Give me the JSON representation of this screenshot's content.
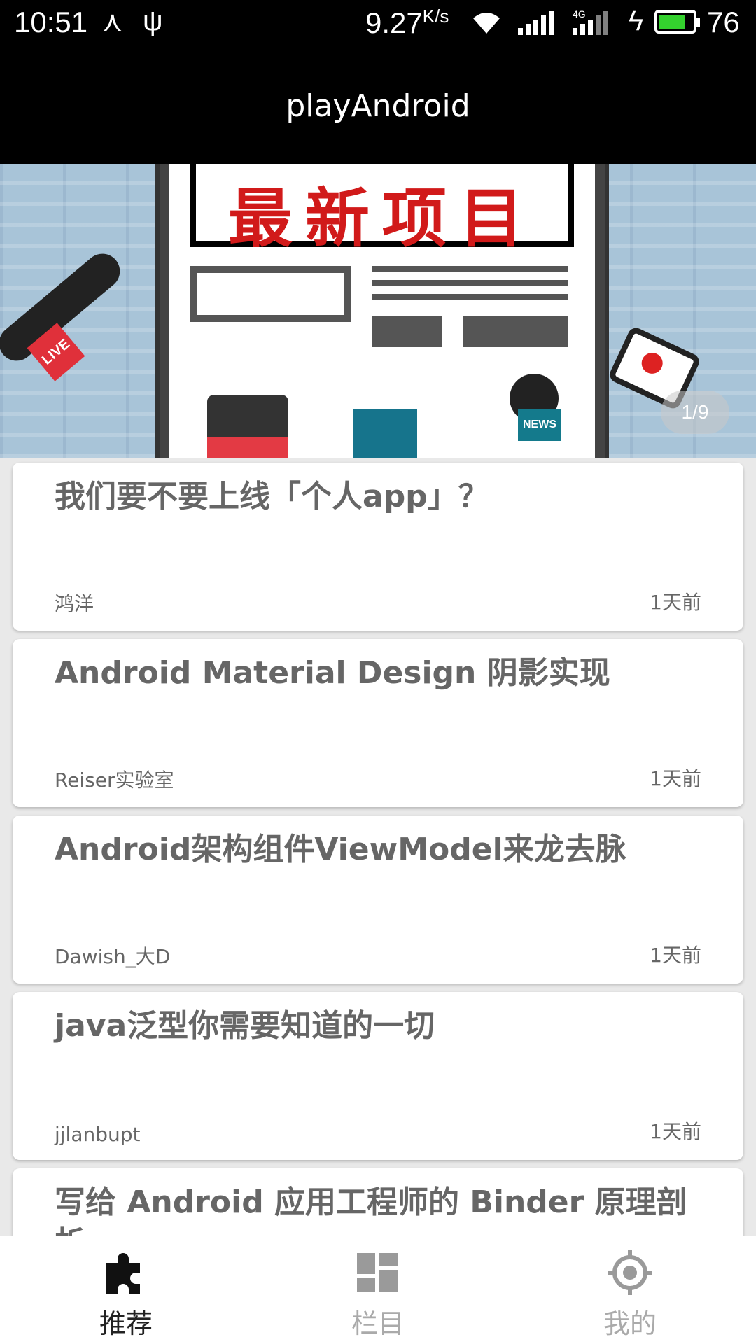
{
  "status_bar": {
    "time": "10:51",
    "speed_value": "9.27",
    "speed_unit": "K/s",
    "network_label": "4G",
    "battery_level": "76"
  },
  "app_bar": {
    "title": "playAndroid"
  },
  "banner": {
    "headline": "最新项目",
    "live_tag": "LIVE",
    "news_tag": "NEWS",
    "page_indicator": "1/9"
  },
  "articles": [
    {
      "title": "我们要不要上线「个人app」？",
      "author": "鸿洋",
      "time": "1天前"
    },
    {
      "title": "Android Material Design 阴影实现",
      "author": "Reiser实验室",
      "time": "1天前"
    },
    {
      "title": "Android架构组件ViewModel来龙去脉",
      "author": "Dawish_大D",
      "time": "1天前"
    },
    {
      "title": "java泛型你需要知道的一切",
      "author": "jjlanbupt",
      "time": "1天前"
    },
    {
      "title": "写给 Android 应用工程师的 Binder 原理剖析",
      "author": "",
      "time": ""
    }
  ],
  "bottom_nav": {
    "items": [
      {
        "label": "推荐",
        "icon": "puzzle-icon",
        "active": true
      },
      {
        "label": "栏目",
        "icon": "dashboard-icon",
        "active": false
      },
      {
        "label": "我的",
        "icon": "location-icon",
        "active": false
      }
    ]
  }
}
